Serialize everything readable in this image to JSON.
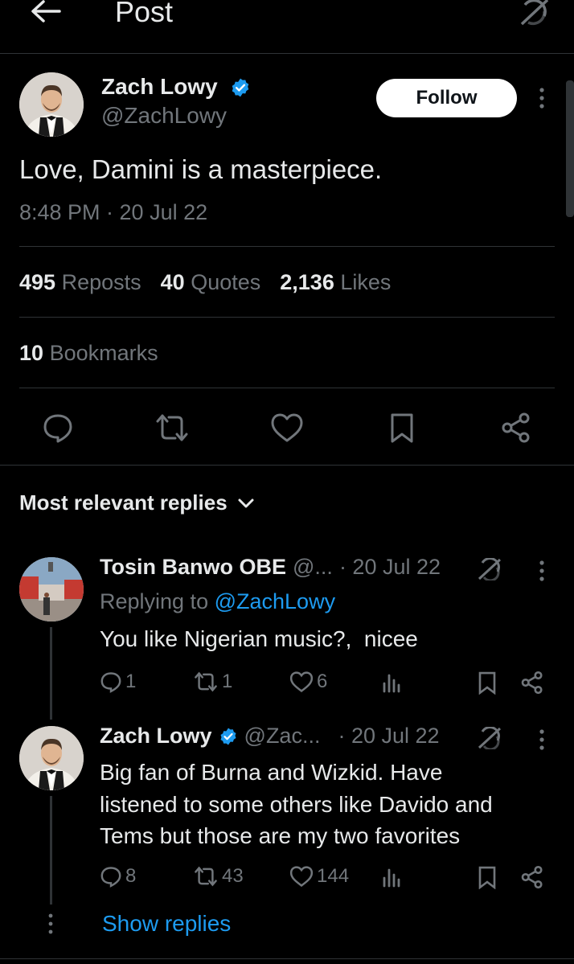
{
  "header": {
    "title": "Post"
  },
  "post": {
    "author_name": "Zach Lowy",
    "author_handle": "@ZachLowy",
    "follow_label": "Follow",
    "text": "Love, Damini is a masterpiece.",
    "timestamp": "8:48 PM · 20 Jul 22",
    "stats": {
      "reposts_count": "495",
      "reposts_label": "Reposts",
      "quotes_count": "40",
      "quotes_label": "Quotes",
      "likes_count": "2,136",
      "likes_label": "Likes",
      "bookmarks_count": "10",
      "bookmarks_label": "Bookmarks"
    }
  },
  "replies_filter": {
    "label": "Most relevant replies"
  },
  "replies": [
    {
      "name": "Tosin Banwo OBE",
      "handle": "@...",
      "date": "· 20 Jul 22",
      "replying_prefix": "Replying to",
      "replying_to": "@ZachLowy",
      "text": "You like Nigerian music?,  nicee",
      "replies": "1",
      "reposts": "1",
      "likes": "6"
    },
    {
      "name": "Zach Lowy",
      "handle": "@Zac...",
      "date": "· 20 Jul 22",
      "text_lines": [
        "Big fan of Burna and Wizkid. Have",
        "listened to some others like Davido and",
        "Tems but those are my two favorites"
      ],
      "replies": "8",
      "reposts": "43",
      "likes": "144"
    }
  ],
  "show_replies_label": "Show replies",
  "colors": {
    "background": "#000000",
    "text": "#e7e9ea",
    "muted": "#71767b",
    "link": "#1d9bf0",
    "verified": "#1d9bf0",
    "divider": "#2f3336"
  }
}
